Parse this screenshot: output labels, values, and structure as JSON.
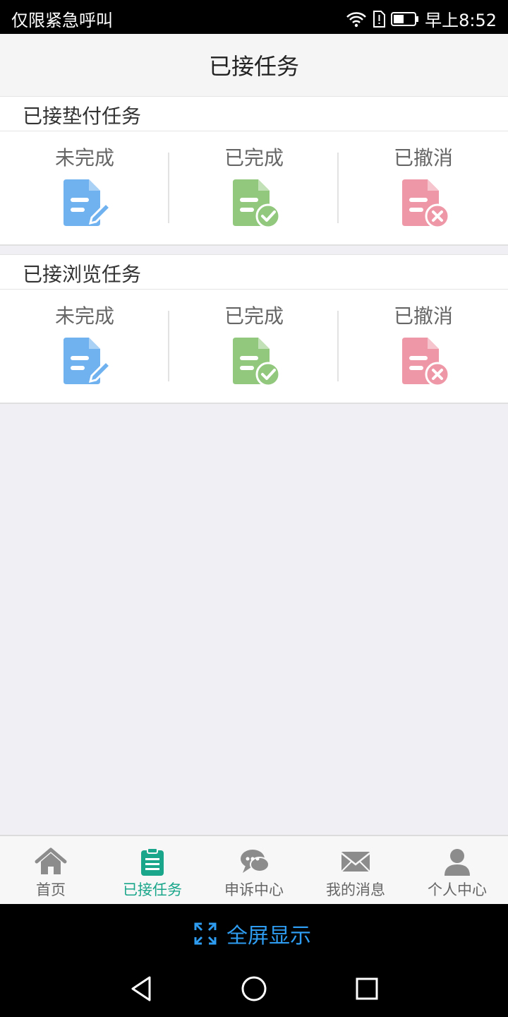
{
  "status_bar": {
    "carrier": "仅限紧急呼叫",
    "time": "早上8:52",
    "icons": [
      "wifi-icon",
      "sim-alert-icon",
      "battery-icon"
    ]
  },
  "header": {
    "title": "已接任务"
  },
  "sections": [
    {
      "title": "已接垫付任务",
      "items": [
        {
          "label": "未完成",
          "icon": "document-edit-icon",
          "color": "#6fb2ef"
        },
        {
          "label": "已完成",
          "icon": "document-check-icon",
          "color": "#92c87e"
        },
        {
          "label": "已撤消",
          "icon": "document-cancel-icon",
          "color": "#ee97a6"
        }
      ]
    },
    {
      "title": "已接浏览任务",
      "items": [
        {
          "label": "未完成",
          "icon": "document-edit-icon",
          "color": "#6fb2ef"
        },
        {
          "label": "已完成",
          "icon": "document-check-icon",
          "color": "#92c87e"
        },
        {
          "label": "已撤消",
          "icon": "document-cancel-icon",
          "color": "#ee97a6"
        }
      ]
    }
  ],
  "bottom_nav": {
    "active_color": "#1aa68a",
    "inactive_color": "#8c8c8c",
    "items": [
      {
        "label": "首页",
        "icon": "home-icon",
        "active": false
      },
      {
        "label": "已接任务",
        "icon": "clipboard-icon",
        "active": true
      },
      {
        "label": "申诉中心",
        "icon": "chat-bubbles-icon",
        "active": false
      },
      {
        "label": "我的消息",
        "icon": "envelope-icon",
        "active": false
      },
      {
        "label": "个人中心",
        "icon": "user-icon",
        "active": false
      }
    ]
  },
  "fullscreen": {
    "label": "全屏显示",
    "icon": "expand-icon"
  },
  "system_nav": [
    "back-icon",
    "home-circle-icon",
    "recents-icon"
  ]
}
